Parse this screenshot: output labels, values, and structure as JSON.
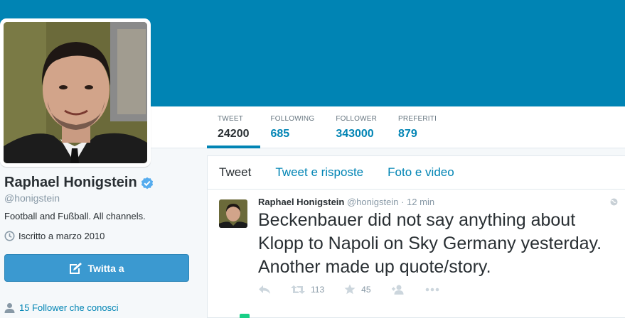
{
  "profile": {
    "name": "Raphael Honigstein",
    "handle": "@honigstein",
    "bio": "Football and Fußball. All channels.",
    "joined": "Iscritto a marzo 2010",
    "tweet_button": "Twitta a",
    "followers_you_know": "15 Follower che conosci"
  },
  "stats": [
    {
      "label": "Tweet",
      "value": "24200"
    },
    {
      "label": "Following",
      "value": "685"
    },
    {
      "label": "Follower",
      "value": "343000"
    },
    {
      "label": "Preferiti",
      "value": "879"
    }
  ],
  "tabs": [
    {
      "label": "Tweet"
    },
    {
      "label": "Tweet e risposte"
    },
    {
      "label": "Foto e video"
    }
  ],
  "tweet": {
    "name": "Raphael Honigstein",
    "handle": "@honigstein",
    "dot": "·",
    "time": "12 min",
    "text": "Beckenbauer did not say anything about Klopp to Napoli on Sky Germany yesterday. Another made up quote/story.",
    "retweets": "113",
    "favorites": "45"
  },
  "colors": {
    "banner": "#0084b4",
    "accent": "#0084b4",
    "button": "#3b99d0",
    "verified": "#55acee"
  },
  "icons": [
    "verified-badge-icon",
    "calendar-icon",
    "compose-icon",
    "person-icon",
    "reply-icon",
    "retweet-icon",
    "star-icon",
    "follow-icon",
    "more-icon",
    "globe-icon"
  ]
}
